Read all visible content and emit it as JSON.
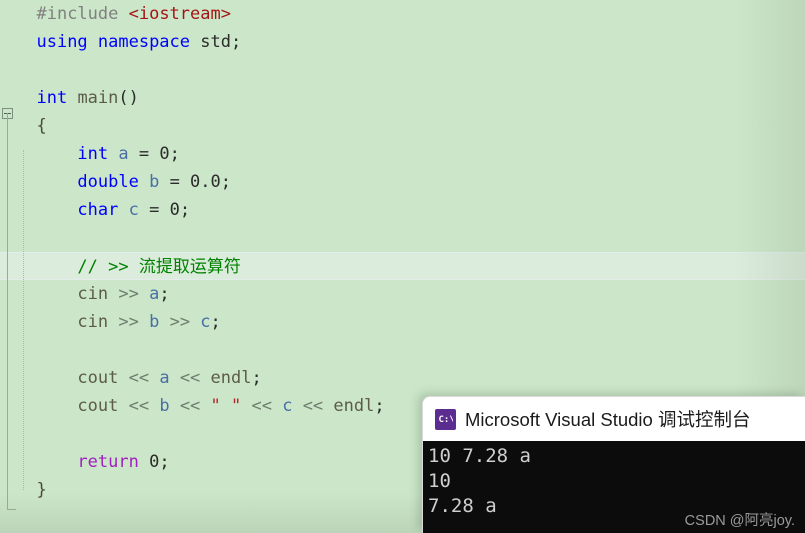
{
  "editor": {
    "background_color": "#cbe6c8",
    "current_line_color": "#dcecdc",
    "lines": [
      {
        "n": 1,
        "current": false,
        "indent": 0,
        "tokens": [
          {
            "cls": "t-pre",
            "text": "#include "
          },
          {
            "cls": "t-inc",
            "text": "<iostream>"
          }
        ]
      },
      {
        "n": 2,
        "current": false,
        "indent": 0,
        "tokens": [
          {
            "cls": "t-kw",
            "text": "using namespace "
          },
          {
            "cls": "t-plain",
            "text": "std;"
          }
        ]
      },
      {
        "n": 3,
        "current": false,
        "indent": 0,
        "tokens": []
      },
      {
        "n": 4,
        "current": false,
        "indent": 0,
        "tokens": [
          {
            "cls": "t-kw",
            "text": "int "
          },
          {
            "cls": "t-obj",
            "text": "main"
          },
          {
            "cls": "t-plain",
            "text": "()"
          }
        ]
      },
      {
        "n": 5,
        "current": false,
        "indent": 0,
        "tokens": [
          {
            "cls": "t-brace",
            "text": "{"
          }
        ]
      },
      {
        "n": 6,
        "current": false,
        "indent": 1,
        "tokens": [
          {
            "cls": "t-kw",
            "text": "int "
          },
          {
            "cls": "t-var",
            "text": "a "
          },
          {
            "cls": "t-plain",
            "text": "= "
          },
          {
            "cls": "t-num",
            "text": "0;"
          }
        ]
      },
      {
        "n": 7,
        "current": false,
        "indent": 1,
        "tokens": [
          {
            "cls": "t-kw",
            "text": "double "
          },
          {
            "cls": "t-var",
            "text": "b "
          },
          {
            "cls": "t-plain",
            "text": "= "
          },
          {
            "cls": "t-num",
            "text": "0.0;"
          }
        ]
      },
      {
        "n": 8,
        "current": false,
        "indent": 1,
        "tokens": [
          {
            "cls": "t-kw",
            "text": "char "
          },
          {
            "cls": "t-var",
            "text": "c "
          },
          {
            "cls": "t-plain",
            "text": "= "
          },
          {
            "cls": "t-num",
            "text": "0;"
          }
        ]
      },
      {
        "n": 9,
        "current": false,
        "indent": 1,
        "tokens": []
      },
      {
        "n": 10,
        "current": true,
        "indent": 1,
        "tokens": [
          {
            "cls": "t-cmt",
            "text": "// >> 流提取运算符"
          }
        ]
      },
      {
        "n": 11,
        "current": false,
        "indent": 1,
        "tokens": [
          {
            "cls": "t-obj",
            "text": "cin "
          },
          {
            "cls": "t-op",
            "text": ">> "
          },
          {
            "cls": "t-var",
            "text": "a"
          },
          {
            "cls": "t-plain",
            "text": ";"
          }
        ]
      },
      {
        "n": 12,
        "current": false,
        "indent": 1,
        "tokens": [
          {
            "cls": "t-obj",
            "text": "cin "
          },
          {
            "cls": "t-op",
            "text": ">> "
          },
          {
            "cls": "t-var",
            "text": "b "
          },
          {
            "cls": "t-op",
            "text": ">> "
          },
          {
            "cls": "t-var",
            "text": "c"
          },
          {
            "cls": "t-plain",
            "text": ";"
          }
        ]
      },
      {
        "n": 13,
        "current": false,
        "indent": 1,
        "tokens": []
      },
      {
        "n": 14,
        "current": false,
        "indent": 1,
        "tokens": [
          {
            "cls": "t-obj",
            "text": "cout "
          },
          {
            "cls": "t-op",
            "text": "<< "
          },
          {
            "cls": "t-var",
            "text": "a "
          },
          {
            "cls": "t-op",
            "text": "<< "
          },
          {
            "cls": "t-obj",
            "text": "endl"
          },
          {
            "cls": "t-plain",
            "text": ";"
          }
        ]
      },
      {
        "n": 15,
        "current": false,
        "indent": 1,
        "tokens": [
          {
            "cls": "t-obj",
            "text": "cout "
          },
          {
            "cls": "t-op",
            "text": "<< "
          },
          {
            "cls": "t-var",
            "text": "b "
          },
          {
            "cls": "t-op",
            "text": "<< "
          },
          {
            "cls": "t-str",
            "text": "\" \" "
          },
          {
            "cls": "t-op",
            "text": "<< "
          },
          {
            "cls": "t-var",
            "text": "c "
          },
          {
            "cls": "t-op",
            "text": "<< "
          },
          {
            "cls": "t-obj",
            "text": "endl"
          },
          {
            "cls": "t-plain",
            "text": ";"
          }
        ]
      },
      {
        "n": 16,
        "current": false,
        "indent": 1,
        "tokens": []
      },
      {
        "n": 17,
        "current": false,
        "indent": 1,
        "tokens": [
          {
            "cls": "t-ret",
            "text": "return "
          },
          {
            "cls": "t-num",
            "text": "0;"
          }
        ]
      },
      {
        "n": 18,
        "current": false,
        "indent": 0,
        "tokens": [
          {
            "cls": "t-brace",
            "text": "}"
          }
        ]
      }
    ],
    "fold_marker": {
      "name": "collapse-region",
      "glyph": "minus"
    }
  },
  "console": {
    "icon_name": "command-prompt-icon",
    "icon_glyph": "C:\\",
    "icon_color": "#5c2d91",
    "title": "Microsoft Visual Studio 调试控制台",
    "background_color": "#0c0c0c",
    "output_lines": [
      "10 7.28 a",
      "10",
      "7.28 a"
    ],
    "watermark": "CSDN @阿亮joy."
  }
}
